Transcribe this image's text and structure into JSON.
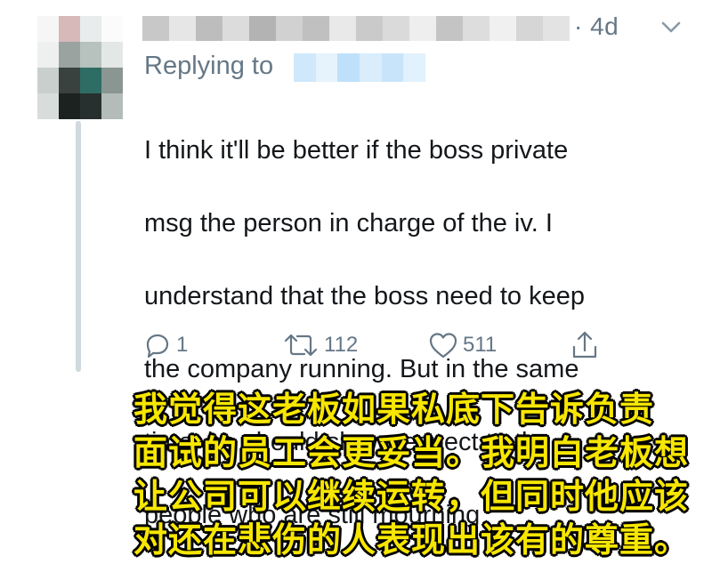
{
  "tweet": {
    "timestamp": "· 4d",
    "replying_label": "Replying to",
    "text_lines": [
      "I think it'll be better if the boss private",
      "msg the person in charge of the iv. I",
      "understand that the boss need to keep",
      "the company running. But in the same",
      "time, he should show respect to the",
      "people who are still mourning"
    ],
    "actions": {
      "reply_count": "1",
      "retweet_count": "112",
      "like_count": "511"
    }
  },
  "caption": {
    "lines": [
      "我觉得这老板如果私底下告诉负责",
      "面试的员工会更妥当。我明白老板想",
      "让公司可以继续运转，但同时他应该",
      "对还在悲伤的人表现出该有的尊重。"
    ]
  },
  "colors": {
    "muted": "#657786",
    "text": "#14171a",
    "caption": "#f7e600",
    "thread_line": "#cfd9de"
  },
  "icons": [
    "reply-icon",
    "retweet-icon",
    "like-icon",
    "share-icon",
    "chevron-down-icon"
  ]
}
